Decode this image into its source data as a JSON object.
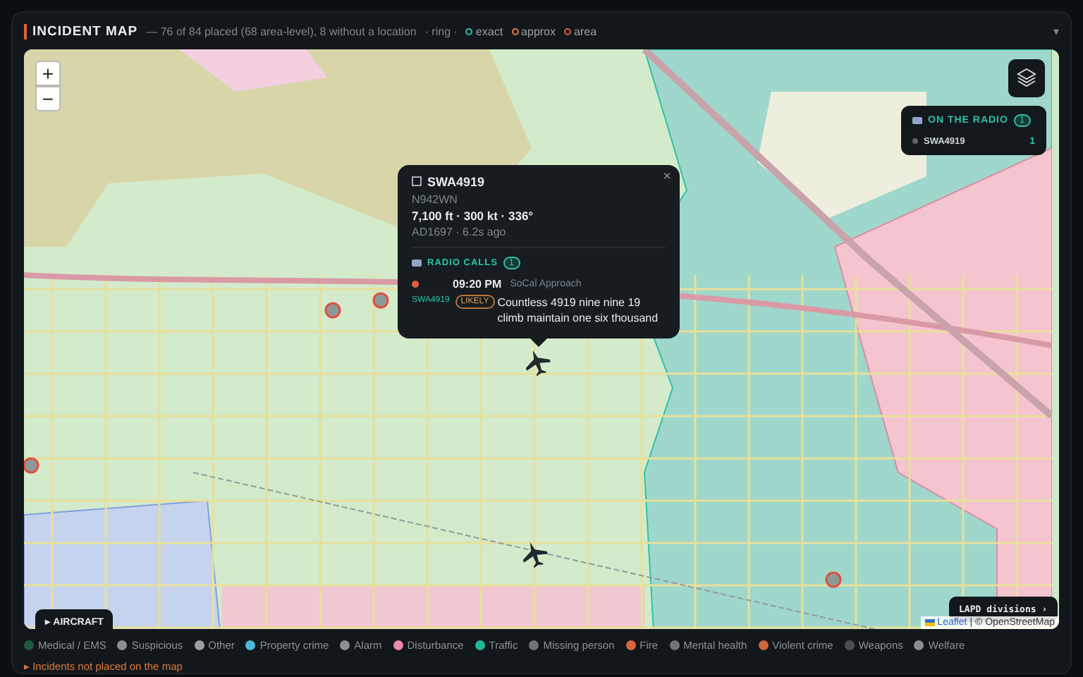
{
  "header": {
    "title": "INCIDENT MAP",
    "summary": "— 76 of 84 placed (68 area-level), 8 without a location",
    "ring_label": "· ring ·",
    "rings": [
      {
        "label": "exact",
        "color": "#2ec4a6"
      },
      {
        "label": "approx",
        "color": "#e07a3c"
      },
      {
        "label": "area",
        "color": "#e0603c"
      }
    ],
    "collapse": "▾"
  },
  "map": {
    "zoom_in": "+",
    "zoom_out": "−",
    "aircraft_button": "▸ AIRCRAFT",
    "divisions_button": "LAPD divisions ›",
    "attribution_link": "Leaflet",
    "attribution_text": "| © OpenStreetMap"
  },
  "popup": {
    "callsign": "SWA4919",
    "registration": "N942WN",
    "flight": "7,100 ft · 300 kt · 336°",
    "meta": "AD1697 · 6.2s ago",
    "close": "×",
    "section": "RADIO CALLS",
    "count": "1",
    "calls": [
      {
        "time": "09:20 PM",
        "facility": "SoCal Approach",
        "callsign": "SWA4919",
        "confidence": "LIKELY",
        "text": "Countless 4919 nine nine 19 climb maintain one six thousand"
      }
    ]
  },
  "radio_panel": {
    "title": "ON THE RADIO",
    "count": "1",
    "items": [
      {
        "callsign": "SWA4919",
        "count": "1"
      }
    ]
  },
  "legend": [
    {
      "label": "Medical / EMS",
      "color": "#1f5a40"
    },
    {
      "label": "Suspicious",
      "color": "#8a8f94"
    },
    {
      "label": "Other",
      "color": "#9a9ea2"
    },
    {
      "label": "Property crime",
      "color": "#4fb8d8"
    },
    {
      "label": "Alarm",
      "color": "#8a8f94"
    },
    {
      "label": "Disturbance",
      "color": "#e88aa8"
    },
    {
      "label": "Traffic",
      "color": "#1fb89a"
    },
    {
      "label": "Missing person",
      "color": "#6f7478"
    },
    {
      "label": "Fire",
      "color": "#d9673a"
    },
    {
      "label": "Mental health",
      "color": "#6f7478"
    },
    {
      "label": "Violent crime",
      "color": "#d2643c"
    },
    {
      "label": "Weapons",
      "color": "#4a4f54"
    },
    {
      "label": "Welfare",
      "color": "#8a8f94"
    }
  ],
  "unplaced_toggle": "▸ Incidents not placed on the map"
}
